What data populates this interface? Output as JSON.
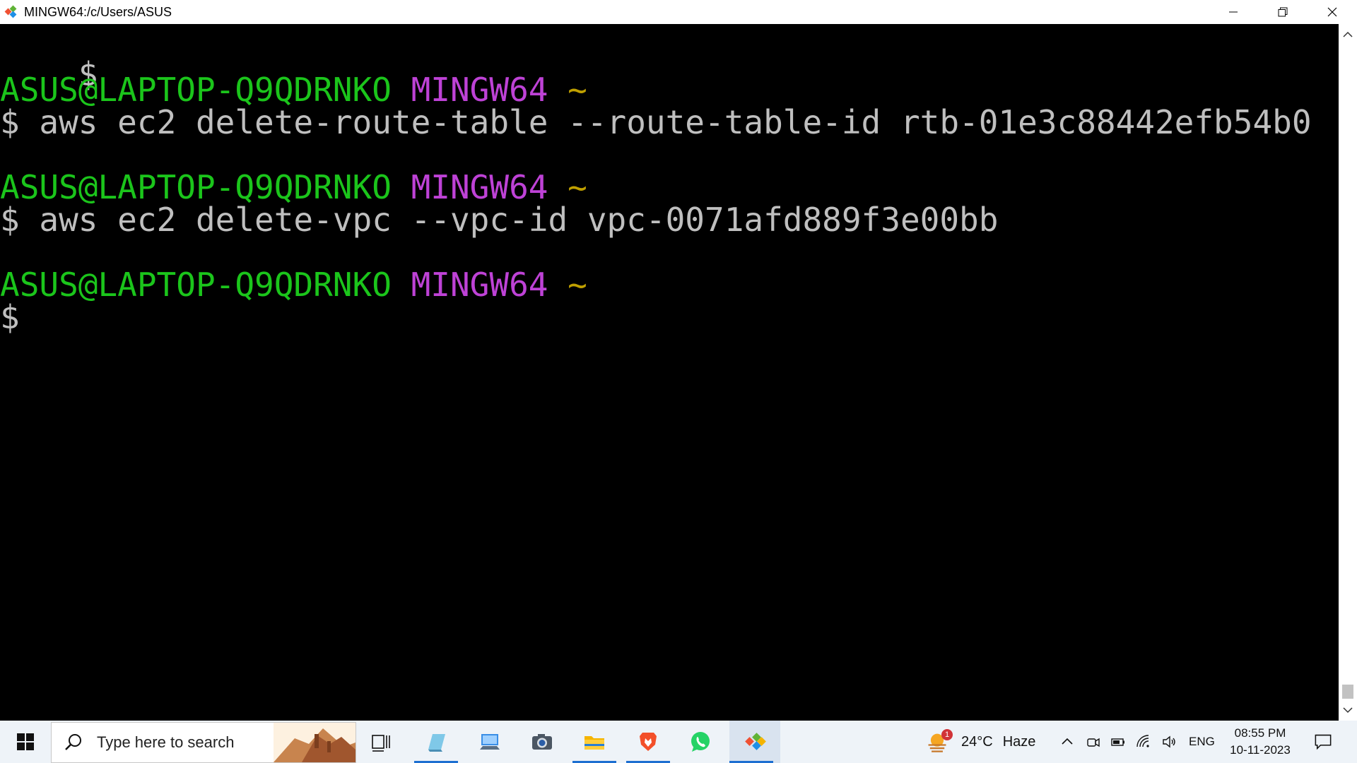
{
  "window": {
    "title": "MINGW64:/c/Users/ASUS"
  },
  "terminal": {
    "lines": [
      {
        "prompt_char": "$"
      },
      {
        "user_host": "ASUS@LAPTOP-Q9QDRNKO",
        "shell": "MINGW64",
        "path": "~"
      },
      {
        "prompt_char": "$",
        "command": " aws ec2 delete-route-table --route-table-id rtb-01e3c88442efb54b0"
      },
      {
        "user_host": "ASUS@LAPTOP-Q9QDRNKO",
        "shell": "MINGW64",
        "path": "~"
      },
      {
        "prompt_char": "$",
        "command": " aws ec2 delete-vpc --vpc-id vpc-0071afd889f3e00bb"
      },
      {
        "user_host": "ASUS@LAPTOP-Q9QDRNKO",
        "shell": "MINGW64",
        "path": "~"
      },
      {
        "prompt_char": "$"
      }
    ],
    "colors": {
      "user_host": "#1bc51b",
      "shell": "#be42d6",
      "path": "#c0a000",
      "text": "#bfbfbf",
      "background": "#000000"
    }
  },
  "taskbar": {
    "search_placeholder": "Type here to search",
    "apps": [
      "task-view",
      "notes",
      "computer",
      "camera",
      "file-explorer",
      "brave",
      "whatsapp",
      "git-bash"
    ],
    "weather": {
      "temperature": "24°C",
      "condition": "Haze",
      "badge": "1"
    },
    "language": "ENG",
    "clock": {
      "time": "08:55 PM",
      "date": "10-11-2023"
    }
  }
}
